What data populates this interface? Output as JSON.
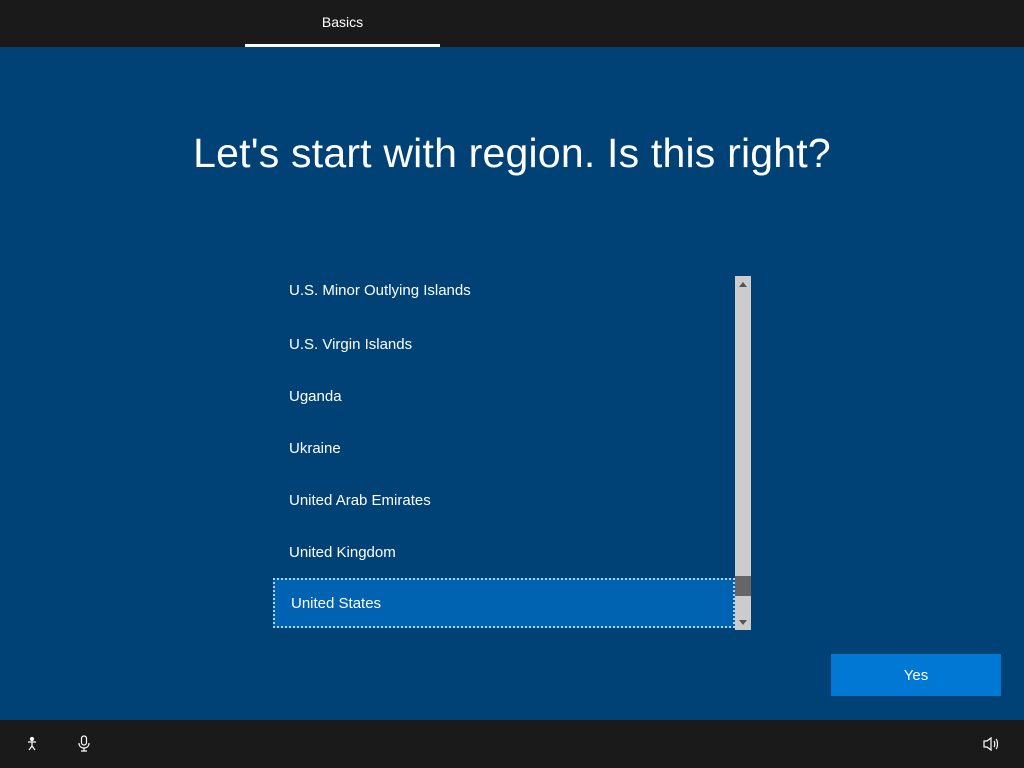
{
  "tabs": {
    "active": "Basics"
  },
  "heading": "Let's start with region. Is this right?",
  "regions": [
    "U.S. Minor Outlying Islands",
    "U.S. Virgin Islands",
    "Uganda",
    "Ukraine",
    "United Arab Emirates",
    "United Kingdom",
    "United States"
  ],
  "selected_index": 6,
  "buttons": {
    "confirm": "Yes"
  }
}
